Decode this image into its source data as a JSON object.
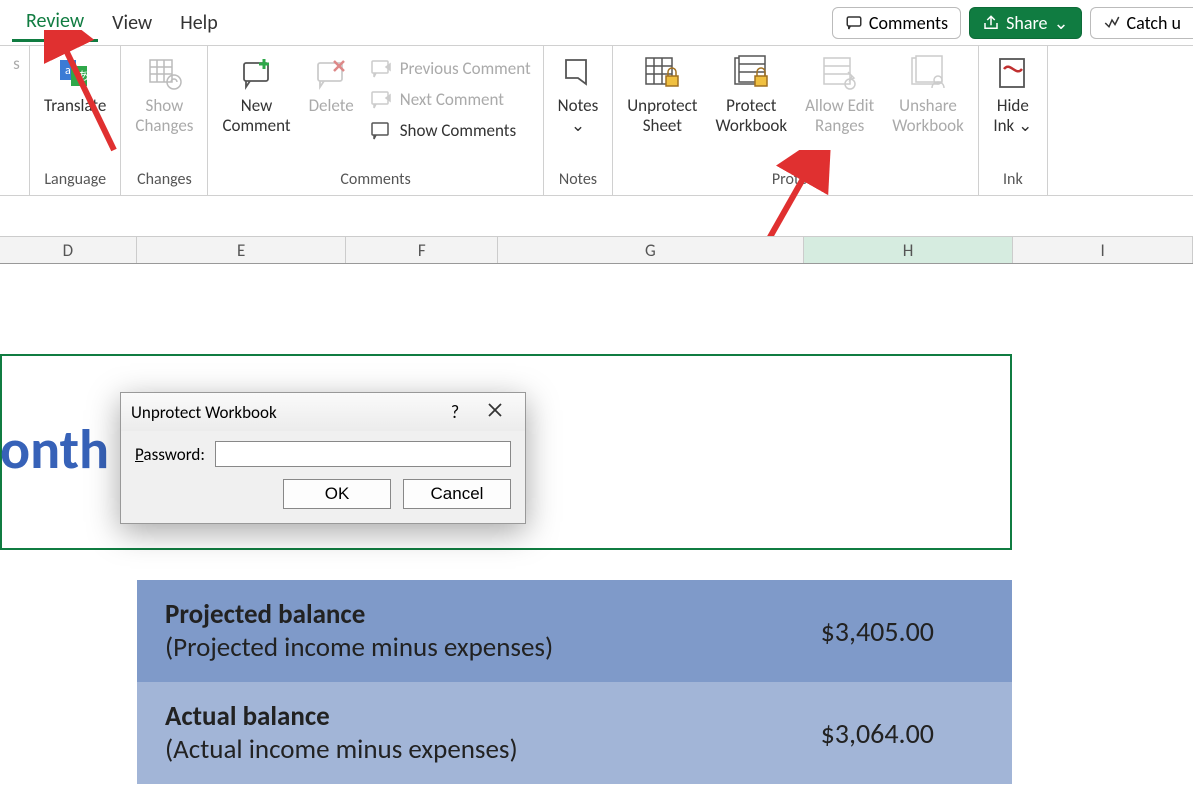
{
  "tabs": {
    "review": "Review",
    "view": "View",
    "help": "Help"
  },
  "topbar": {
    "comments": "Comments",
    "share": "Share",
    "catch_up": "Catch u"
  },
  "ribbon": {
    "language": {
      "group": "Language",
      "translate": "Translate"
    },
    "changes": {
      "group": "Changes",
      "show_changes": "Show\nChanges"
    },
    "comments": {
      "group": "Comments",
      "new_comment": "New\nComment",
      "delete": "Delete",
      "previous": "Previous Comment",
      "next": "Next Comment",
      "show": "Show Comments"
    },
    "notes": {
      "group": "Notes",
      "notes": "Notes"
    },
    "protect": {
      "group": "Protect",
      "unprotect_sheet": "Unprotect\nSheet",
      "protect_workbook": "Protect\nWorkbook",
      "allow_edit": "Allow Edit\nRanges",
      "unshare": "Unshare\nWorkbook"
    },
    "ink": {
      "group": "Ink",
      "hide_ink": "Hide\nInk"
    }
  },
  "columns": [
    "D",
    "E",
    "F",
    "G",
    "H",
    "I"
  ],
  "sheet": {
    "title_fragment": "onth",
    "rows": [
      {
        "label_bold": "Projected balance",
        "label_sub": "(Projected income minus expenses)",
        "value": "$3,405.00"
      },
      {
        "label_bold": "Actual balance",
        "label_sub": "(Actual income minus expenses)",
        "value": "$3,064.00"
      }
    ]
  },
  "dialog": {
    "title": "Unprotect Workbook",
    "password_label": "Password:",
    "password_key": "P",
    "ok": "OK",
    "cancel": "Cancel"
  }
}
